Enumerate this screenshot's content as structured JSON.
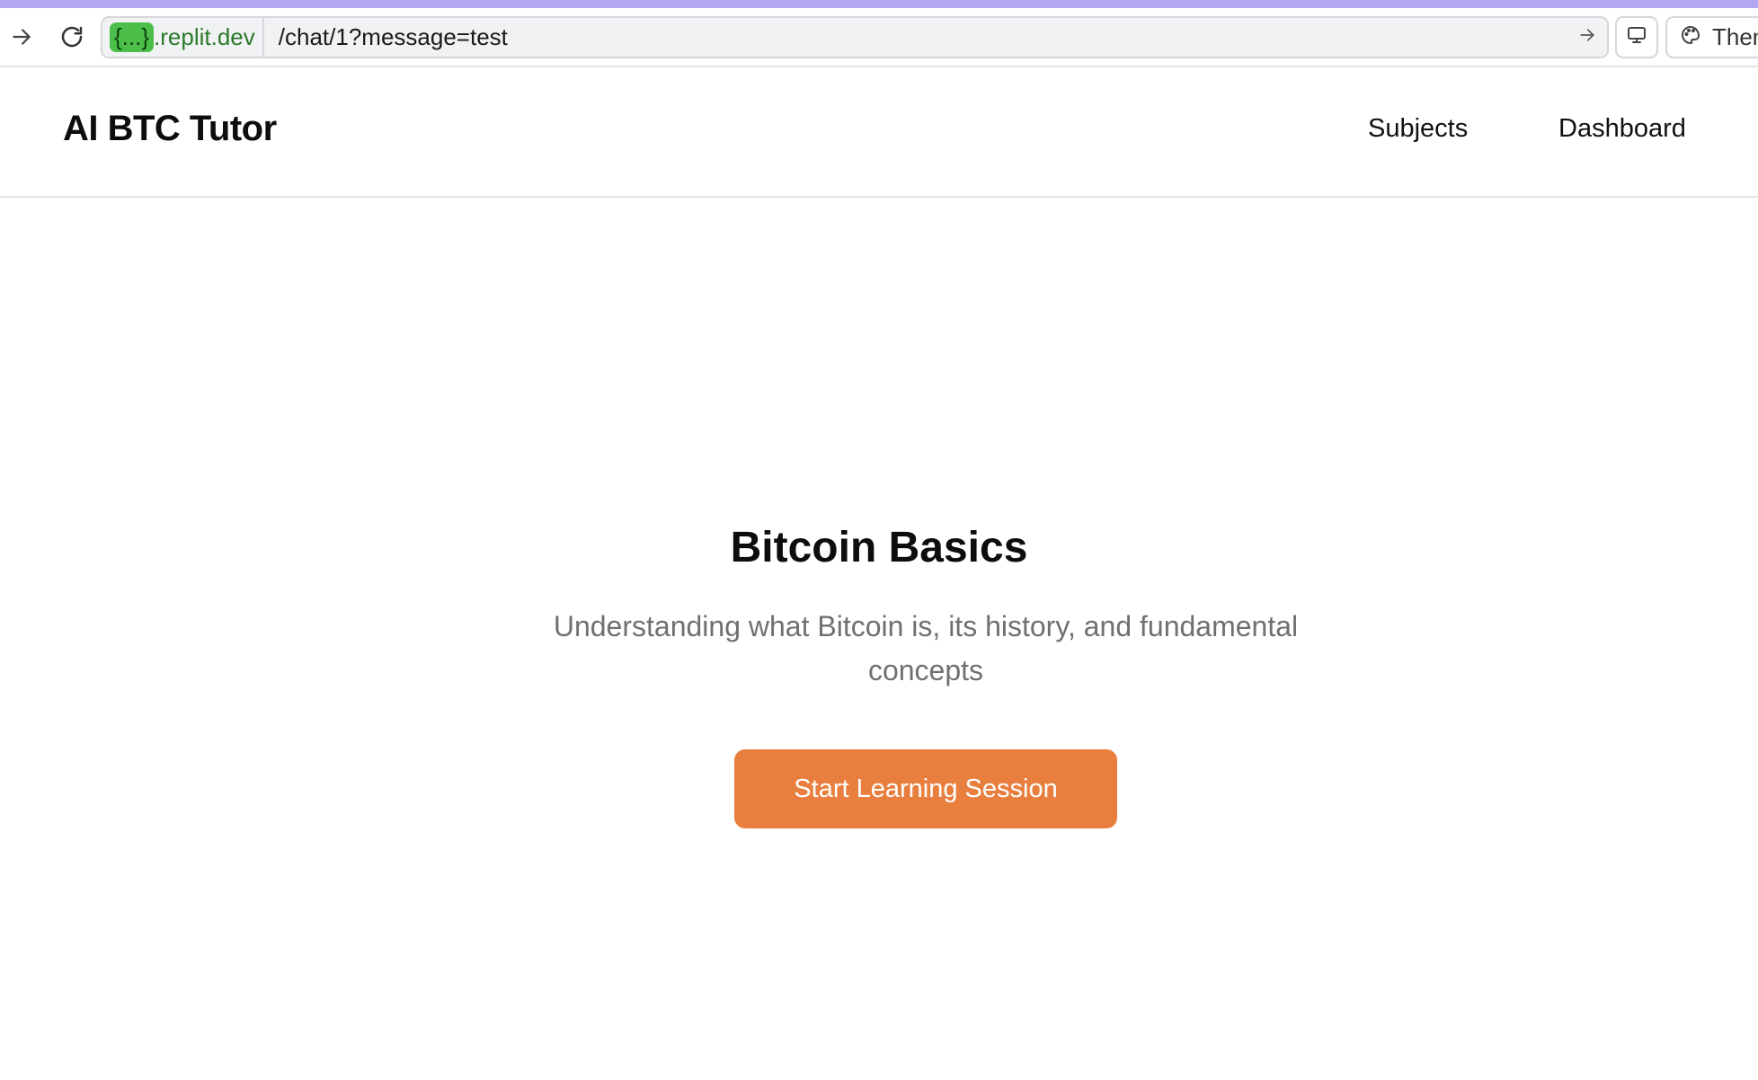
{
  "browser": {
    "host_chip": "{...}",
    "host": ".replit.dev",
    "path": "/chat/1?message=test",
    "theme_label": "Them"
  },
  "icons": {
    "forward": "arrow-right-icon",
    "reload": "reload-icon",
    "go": "arrow-right-icon",
    "device": "monitor-icon",
    "theme": "palette-icon"
  },
  "header": {
    "brand": "AI BTC Tutor",
    "nav": {
      "subjects": "Subjects",
      "dashboard": "Dashboard"
    }
  },
  "hero": {
    "title": "Bitcoin Basics",
    "description": "Understanding what Bitcoin is, its history, and fundamental concepts",
    "cta_label": "Start Learning Session"
  },
  "colors": {
    "accent_bar": "#b3a6f2",
    "host_chip": "#4cbf4a",
    "cta": "#e97f3e"
  }
}
